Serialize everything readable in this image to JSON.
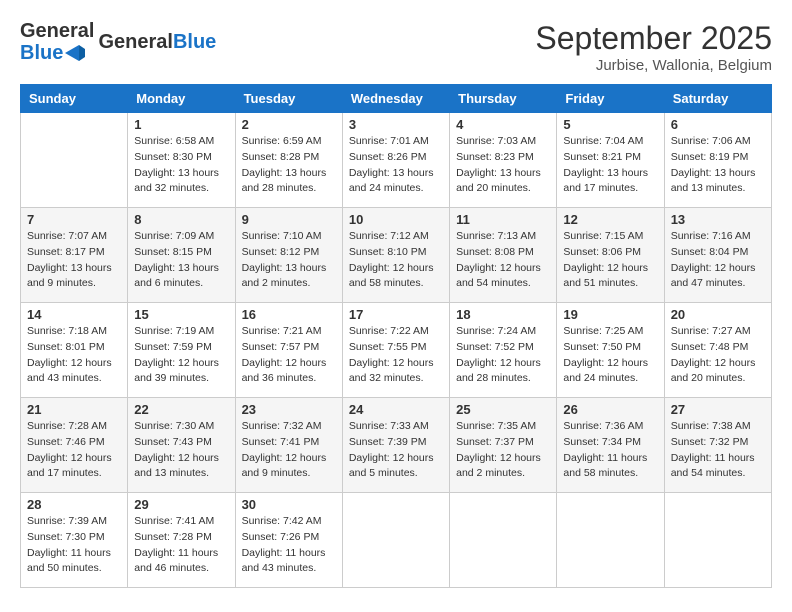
{
  "header": {
    "logo_text_general": "General",
    "logo_text_blue": "Blue",
    "month_year": "September 2025",
    "location": "Jurbise, Wallonia, Belgium"
  },
  "days_of_week": [
    "Sunday",
    "Monday",
    "Tuesday",
    "Wednesday",
    "Thursday",
    "Friday",
    "Saturday"
  ],
  "weeks": [
    [
      {
        "day": "",
        "sunrise": "",
        "sunset": "",
        "daylight": ""
      },
      {
        "day": "1",
        "sunrise": "Sunrise: 6:58 AM",
        "sunset": "Sunset: 8:30 PM",
        "daylight": "Daylight: 13 hours and 32 minutes."
      },
      {
        "day": "2",
        "sunrise": "Sunrise: 6:59 AM",
        "sunset": "Sunset: 8:28 PM",
        "daylight": "Daylight: 13 hours and 28 minutes."
      },
      {
        "day": "3",
        "sunrise": "Sunrise: 7:01 AM",
        "sunset": "Sunset: 8:26 PM",
        "daylight": "Daylight: 13 hours and 24 minutes."
      },
      {
        "day": "4",
        "sunrise": "Sunrise: 7:03 AM",
        "sunset": "Sunset: 8:23 PM",
        "daylight": "Daylight: 13 hours and 20 minutes."
      },
      {
        "day": "5",
        "sunrise": "Sunrise: 7:04 AM",
        "sunset": "Sunset: 8:21 PM",
        "daylight": "Daylight: 13 hours and 17 minutes."
      },
      {
        "day": "6",
        "sunrise": "Sunrise: 7:06 AM",
        "sunset": "Sunset: 8:19 PM",
        "daylight": "Daylight: 13 hours and 13 minutes."
      }
    ],
    [
      {
        "day": "7",
        "sunrise": "Sunrise: 7:07 AM",
        "sunset": "Sunset: 8:17 PM",
        "daylight": "Daylight: 13 hours and 9 minutes."
      },
      {
        "day": "8",
        "sunrise": "Sunrise: 7:09 AM",
        "sunset": "Sunset: 8:15 PM",
        "daylight": "Daylight: 13 hours and 6 minutes."
      },
      {
        "day": "9",
        "sunrise": "Sunrise: 7:10 AM",
        "sunset": "Sunset: 8:12 PM",
        "daylight": "Daylight: 13 hours and 2 minutes."
      },
      {
        "day": "10",
        "sunrise": "Sunrise: 7:12 AM",
        "sunset": "Sunset: 8:10 PM",
        "daylight": "Daylight: 12 hours and 58 minutes."
      },
      {
        "day": "11",
        "sunrise": "Sunrise: 7:13 AM",
        "sunset": "Sunset: 8:08 PM",
        "daylight": "Daylight: 12 hours and 54 minutes."
      },
      {
        "day": "12",
        "sunrise": "Sunrise: 7:15 AM",
        "sunset": "Sunset: 8:06 PM",
        "daylight": "Daylight: 12 hours and 51 minutes."
      },
      {
        "day": "13",
        "sunrise": "Sunrise: 7:16 AM",
        "sunset": "Sunset: 8:04 PM",
        "daylight": "Daylight: 12 hours and 47 minutes."
      }
    ],
    [
      {
        "day": "14",
        "sunrise": "Sunrise: 7:18 AM",
        "sunset": "Sunset: 8:01 PM",
        "daylight": "Daylight: 12 hours and 43 minutes."
      },
      {
        "day": "15",
        "sunrise": "Sunrise: 7:19 AM",
        "sunset": "Sunset: 7:59 PM",
        "daylight": "Daylight: 12 hours and 39 minutes."
      },
      {
        "day": "16",
        "sunrise": "Sunrise: 7:21 AM",
        "sunset": "Sunset: 7:57 PM",
        "daylight": "Daylight: 12 hours and 36 minutes."
      },
      {
        "day": "17",
        "sunrise": "Sunrise: 7:22 AM",
        "sunset": "Sunset: 7:55 PM",
        "daylight": "Daylight: 12 hours and 32 minutes."
      },
      {
        "day": "18",
        "sunrise": "Sunrise: 7:24 AM",
        "sunset": "Sunset: 7:52 PM",
        "daylight": "Daylight: 12 hours and 28 minutes."
      },
      {
        "day": "19",
        "sunrise": "Sunrise: 7:25 AM",
        "sunset": "Sunset: 7:50 PM",
        "daylight": "Daylight: 12 hours and 24 minutes."
      },
      {
        "day": "20",
        "sunrise": "Sunrise: 7:27 AM",
        "sunset": "Sunset: 7:48 PM",
        "daylight": "Daylight: 12 hours and 20 minutes."
      }
    ],
    [
      {
        "day": "21",
        "sunrise": "Sunrise: 7:28 AM",
        "sunset": "Sunset: 7:46 PM",
        "daylight": "Daylight: 12 hours and 17 minutes."
      },
      {
        "day": "22",
        "sunrise": "Sunrise: 7:30 AM",
        "sunset": "Sunset: 7:43 PM",
        "daylight": "Daylight: 12 hours and 13 minutes."
      },
      {
        "day": "23",
        "sunrise": "Sunrise: 7:32 AM",
        "sunset": "Sunset: 7:41 PM",
        "daylight": "Daylight: 12 hours and 9 minutes."
      },
      {
        "day": "24",
        "sunrise": "Sunrise: 7:33 AM",
        "sunset": "Sunset: 7:39 PM",
        "daylight": "Daylight: 12 hours and 5 minutes."
      },
      {
        "day": "25",
        "sunrise": "Sunrise: 7:35 AM",
        "sunset": "Sunset: 7:37 PM",
        "daylight": "Daylight: 12 hours and 2 minutes."
      },
      {
        "day": "26",
        "sunrise": "Sunrise: 7:36 AM",
        "sunset": "Sunset: 7:34 PM",
        "daylight": "Daylight: 11 hours and 58 minutes."
      },
      {
        "day": "27",
        "sunrise": "Sunrise: 7:38 AM",
        "sunset": "Sunset: 7:32 PM",
        "daylight": "Daylight: 11 hours and 54 minutes."
      }
    ],
    [
      {
        "day": "28",
        "sunrise": "Sunrise: 7:39 AM",
        "sunset": "Sunset: 7:30 PM",
        "daylight": "Daylight: 11 hours and 50 minutes."
      },
      {
        "day": "29",
        "sunrise": "Sunrise: 7:41 AM",
        "sunset": "Sunset: 7:28 PM",
        "daylight": "Daylight: 11 hours and 46 minutes."
      },
      {
        "day": "30",
        "sunrise": "Sunrise: 7:42 AM",
        "sunset": "Sunset: 7:26 PM",
        "daylight": "Daylight: 11 hours and 43 minutes."
      },
      {
        "day": "",
        "sunrise": "",
        "sunset": "",
        "daylight": ""
      },
      {
        "day": "",
        "sunrise": "",
        "sunset": "",
        "daylight": ""
      },
      {
        "day": "",
        "sunrise": "",
        "sunset": "",
        "daylight": ""
      },
      {
        "day": "",
        "sunrise": "",
        "sunset": "",
        "daylight": ""
      }
    ]
  ]
}
